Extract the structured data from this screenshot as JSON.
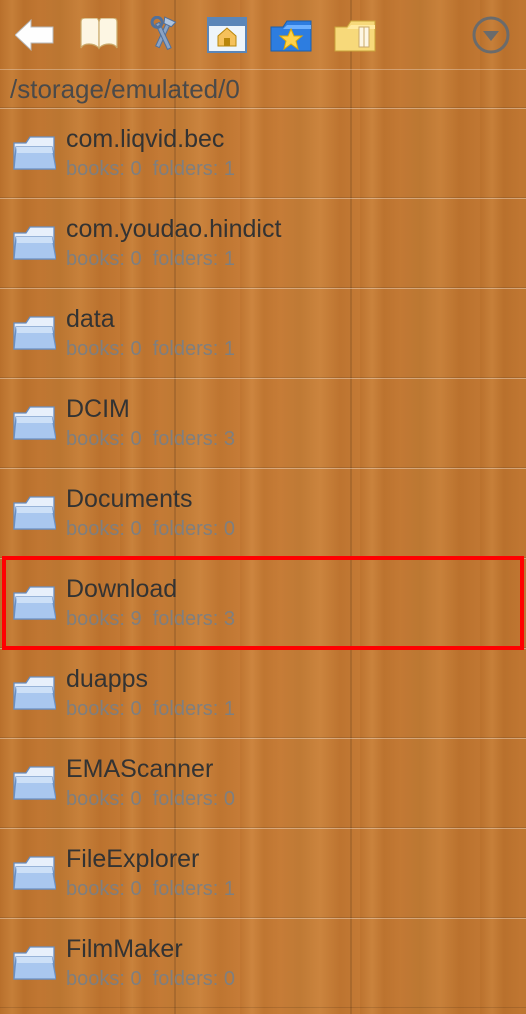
{
  "path": "/storage/emulated/0",
  "meta_labels": {
    "books": "books:",
    "folders": "folders:"
  },
  "folders": [
    {
      "name": "com.liqvid.bec",
      "books": 0,
      "folders": 1,
      "highlighted": false
    },
    {
      "name": "com.youdao.hindict",
      "books": 0,
      "folders": 1,
      "highlighted": false
    },
    {
      "name": "data",
      "books": 0,
      "folders": 1,
      "highlighted": false
    },
    {
      "name": "DCIM",
      "books": 0,
      "folders": 3,
      "highlighted": false
    },
    {
      "name": "Documents",
      "books": 0,
      "folders": 0,
      "highlighted": false
    },
    {
      "name": "Download",
      "books": 9,
      "folders": 3,
      "highlighted": true
    },
    {
      "name": "duapps",
      "books": 0,
      "folders": 1,
      "highlighted": false
    },
    {
      "name": "EMAScanner",
      "books": 0,
      "folders": 0,
      "highlighted": false
    },
    {
      "name": "FileExplorer",
      "books": 0,
      "folders": 1,
      "highlighted": false
    },
    {
      "name": "FilmMaker",
      "books": 0,
      "folders": 0,
      "highlighted": false
    }
  ]
}
